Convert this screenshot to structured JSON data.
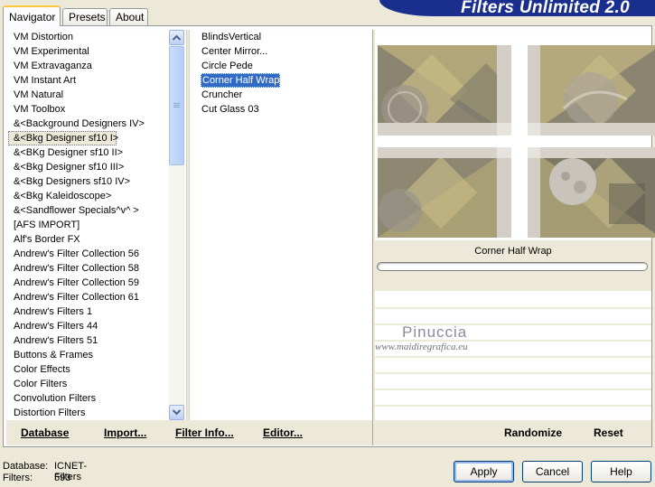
{
  "tabs": [
    {
      "label": "Navigator",
      "active": true
    },
    {
      "label": "Presets",
      "active": false
    },
    {
      "label": "About",
      "active": false
    }
  ],
  "banner": {
    "title": "Filters Unlimited 2.0",
    "color": "#1a2e8e"
  },
  "categories": [
    "VM Distortion",
    "VM Experimental",
    "VM Extravaganza",
    "VM Instant Art",
    "VM Natural",
    "VM Toolbox",
    "&<Background Designers IV>",
    "&<Bkg Designer sf10 I>",
    "&<BKg Designer sf10 II>",
    "&<Bkg Designer sf10 III>",
    "&<Bkg Designers sf10 IV>",
    "&<Bkg Kaleidoscope>",
    "&<Sandflower Specials^v^ >",
    "[AFS IMPORT]",
    "Alf's Border FX",
    "Andrew's Filter Collection 56",
    "Andrew's Filter Collection 58",
    "Andrew's Filter Collection 59",
    "Andrew's Filter Collection 61",
    "Andrew's Filters 1",
    "Andrew's Filters 44",
    "Andrew's Filters 51",
    "Buttons & Frames",
    "Color Effects",
    "Color Filters",
    "Convolution Filters",
    "Distortion Filters"
  ],
  "selected_category_index": 7,
  "filters": [
    "BlindsVertical",
    "Center Mirror...",
    "Circle Pede",
    "Corner Half Wrap",
    "Cruncher",
    "Cut Glass 03"
  ],
  "selected_filter_index": 3,
  "preview": {
    "filter_name": "Corner Half Wrap"
  },
  "watermark": {
    "name": "Pinuccia",
    "url": "www.maidiregrafica.eu"
  },
  "left_actions": {
    "database": "Database",
    "import": "Import...",
    "filter_info": "Filter Info...",
    "editor": "Editor..."
  },
  "right_actions": {
    "randomize": "Randomize",
    "reset": "Reset"
  },
  "status": {
    "database_label": "Database:",
    "database_value": "ICNET-Filters",
    "filters_label": "Filters:",
    "filters_value": "593"
  },
  "buttons": {
    "apply": "Apply",
    "cancel": "Cancel",
    "help": "Help"
  }
}
